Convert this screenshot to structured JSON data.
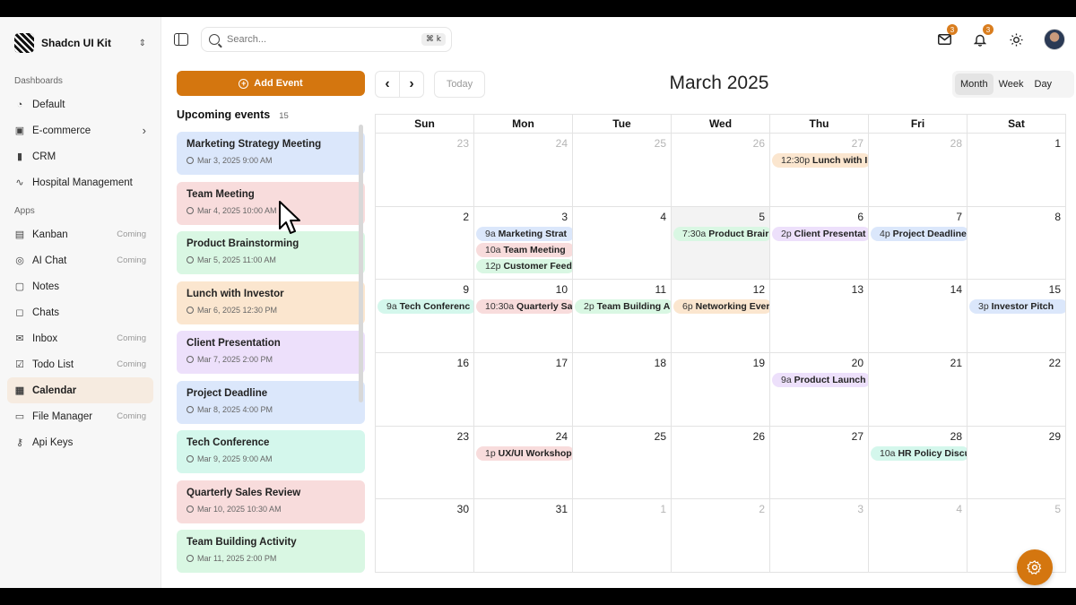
{
  "brand": {
    "name": "Shadcn UI Kit"
  },
  "sidebar": {
    "dashboards_label": "Dashboards",
    "apps_label": "Apps",
    "dashboards": [
      {
        "label": "Default",
        "icon": "pie-chart-icon"
      },
      {
        "label": "E-commerce",
        "icon": "shopping-bag-icon"
      },
      {
        "label": "CRM",
        "icon": "bar-chart-icon"
      },
      {
        "label": "Hospital Management",
        "icon": "activity-icon"
      }
    ],
    "apps": [
      {
        "label": "Kanban",
        "meta": "Coming"
      },
      {
        "label": "AI Chat",
        "meta": "Coming"
      },
      {
        "label": "Notes",
        "meta": ""
      },
      {
        "label": "Chats",
        "meta": ""
      },
      {
        "label": "Inbox",
        "meta": "Coming"
      },
      {
        "label": "Todo List",
        "meta": "Coming"
      },
      {
        "label": "Calendar",
        "meta": ""
      },
      {
        "label": "File Manager",
        "meta": "Coming"
      },
      {
        "label": "Api Keys",
        "meta": ""
      }
    ]
  },
  "search": {
    "placeholder": "Search...",
    "shortcut": "⌘ k"
  },
  "header": {
    "mail_badge": "3",
    "bell_badge": "3"
  },
  "events_panel": {
    "add_label": "Add Event",
    "upcoming_title": "Upcoming events",
    "upcoming_count": "15",
    "events": [
      {
        "title": "Marketing Strategy Meeting",
        "date": "Mar 3, 2025 9:00 AM",
        "color": "#dbe7fb"
      },
      {
        "title": "Team Meeting",
        "date": "Mar 4, 2025 10:00 AM",
        "color": "#f8dcdc"
      },
      {
        "title": "Product Brainstorming",
        "date": "Mar 5, 2025 11:00 AM",
        "color": "#d9f7e3"
      },
      {
        "title": "Lunch with Investor",
        "date": "Mar 6, 2025 12:30 PM",
        "color": "#fbe6cf"
      },
      {
        "title": "Client Presentation",
        "date": "Mar 7, 2025 2:00 PM",
        "color": "#ede0fb"
      },
      {
        "title": "Project Deadline",
        "date": "Mar 8, 2025 4:00 PM",
        "color": "#dbe7fb"
      },
      {
        "title": "Tech Conference",
        "date": "Mar 9, 2025 9:00 AM",
        "color": "#d4f7ec"
      },
      {
        "title": "Quarterly Sales Review",
        "date": "Mar 10, 2025 10:30 AM",
        "color": "#f8dcdc"
      },
      {
        "title": "Team Building Activity",
        "date": "Mar 11, 2025 2:00 PM",
        "color": "#d9f7e3"
      }
    ]
  },
  "calendar": {
    "month_title": "March 2025",
    "today_label": "Today",
    "views": [
      "Month",
      "Week",
      "Day"
    ],
    "active_view": "Month",
    "weekdays": [
      "Sun",
      "Mon",
      "Tue",
      "Wed",
      "Thu",
      "Fri",
      "Sat"
    ],
    "weeks": [
      [
        {
          "d": "23",
          "muted": true
        },
        {
          "d": "24",
          "muted": true
        },
        {
          "d": "25",
          "muted": true
        },
        {
          "d": "26",
          "muted": true
        },
        {
          "d": "27",
          "muted": true,
          "events": [
            {
              "time": "12:30p",
              "title": "Lunch with Ir",
              "color": "c-orange"
            }
          ]
        },
        {
          "d": "28",
          "muted": true
        },
        {
          "d": "1"
        }
      ],
      [
        {
          "d": "2"
        },
        {
          "d": "3",
          "events": [
            {
              "time": "9a",
              "title": "Marketing Strat",
              "color": "c-blue"
            },
            {
              "time": "10a",
              "title": "Team Meeting",
              "color": "c-red"
            },
            {
              "time": "12p",
              "title": "Customer Feed",
              "color": "c-green"
            }
          ]
        },
        {
          "d": "4"
        },
        {
          "d": "5",
          "today": true,
          "events": [
            {
              "time": "7:30a",
              "title": "Product Brair",
              "color": "c-green"
            }
          ]
        },
        {
          "d": "6",
          "events": [
            {
              "time": "2p",
              "title": "Client Presentat",
              "color": "c-purple"
            }
          ]
        },
        {
          "d": "7",
          "events": [
            {
              "time": "4p",
              "title": "Project Deadline",
              "color": "c-blue"
            }
          ]
        },
        {
          "d": "8"
        }
      ],
      [
        {
          "d": "9",
          "events": [
            {
              "time": "9a",
              "title": "Tech Conferenc",
              "color": "c-teal"
            }
          ]
        },
        {
          "d": "10",
          "events": [
            {
              "time": "10:30a",
              "title": "Quarterly Sa",
              "color": "c-red"
            }
          ]
        },
        {
          "d": "11",
          "events": [
            {
              "time": "2p",
              "title": "Team Building A",
              "color": "c-green"
            }
          ]
        },
        {
          "d": "12",
          "events": [
            {
              "time": "6p",
              "title": "Networking Ever",
              "color": "c-orange"
            }
          ]
        },
        {
          "d": "13"
        },
        {
          "d": "14"
        },
        {
          "d": "15",
          "events": [
            {
              "time": "3p",
              "title": "Investor Pitch",
              "color": "c-blue"
            }
          ]
        }
      ],
      [
        {
          "d": "16"
        },
        {
          "d": "17"
        },
        {
          "d": "18"
        },
        {
          "d": "19"
        },
        {
          "d": "20",
          "events": [
            {
              "time": "9a",
              "title": "Product Launch",
              "color": "c-purple"
            }
          ]
        },
        {
          "d": "21"
        },
        {
          "d": "22"
        }
      ],
      [
        {
          "d": "23"
        },
        {
          "d": "24",
          "events": [
            {
              "time": "1p",
              "title": "UX/UI Workshop",
              "color": "c-red"
            }
          ]
        },
        {
          "d": "25"
        },
        {
          "d": "26"
        },
        {
          "d": "27"
        },
        {
          "d": "28",
          "events": [
            {
              "time": "10a",
              "title": "HR Policy Discu",
              "color": "c-teal"
            }
          ]
        },
        {
          "d": "29"
        }
      ],
      [
        {
          "d": "30"
        },
        {
          "d": "31"
        },
        {
          "d": "1",
          "muted": true
        },
        {
          "d": "2",
          "muted": true
        },
        {
          "d": "3",
          "muted": true
        },
        {
          "d": "4",
          "muted": true
        },
        {
          "d": "5",
          "muted": true
        }
      ]
    ]
  }
}
